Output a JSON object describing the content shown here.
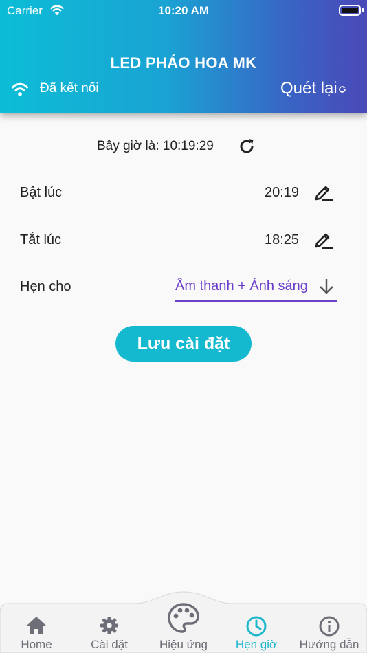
{
  "status_bar": {
    "carrier": "Carrier",
    "time": "10:20 AM"
  },
  "header": {
    "title": "LED PHÁO HOA MK",
    "connection_status": "Đã kết nối",
    "rescan_label": "Quét lại"
  },
  "main": {
    "now_text": "Bây giờ là: 10:19:29",
    "on_time": {
      "label": "Bật lúc",
      "value": "20:19"
    },
    "off_time": {
      "label": "Tắt lúc",
      "value": "18:25"
    },
    "schedule_for": {
      "label": "Hẹn cho",
      "selected": "Âm thanh + Ánh sáng"
    },
    "save_label": "Lưu cài đặt"
  },
  "nav": {
    "items": [
      {
        "label": "Home",
        "icon": "home-icon"
      },
      {
        "label": "Cài đặt",
        "icon": "gear-icon"
      },
      {
        "label": "Hiệu ứng",
        "icon": "palette-icon"
      },
      {
        "label": "Hẹn giờ",
        "icon": "clock-icon",
        "active": true
      },
      {
        "label": "Hướng dẫn",
        "icon": "info-icon"
      }
    ]
  },
  "colors": {
    "accent": "#15b9cf",
    "dropdown": "#6a3fc9",
    "nav_inactive": "#6e6e78",
    "nav_active": "#1eb7cc"
  }
}
